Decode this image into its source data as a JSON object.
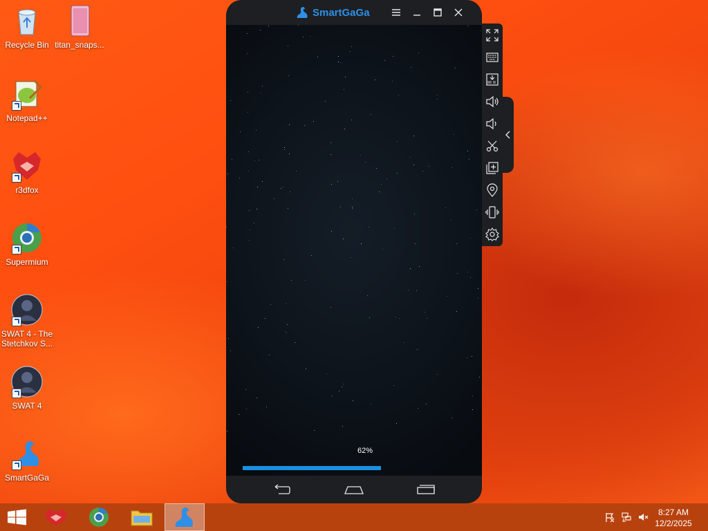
{
  "desktop": {
    "icons": [
      {
        "label": "Recycle Bin"
      },
      {
        "label": "titan_snaps..."
      },
      {
        "label": "Notepad++"
      },
      {
        "label": "r3dfox"
      },
      {
        "label": "Supermium"
      },
      {
        "label": "SWAT 4 - The Stetchkov S..."
      },
      {
        "label": "SWAT 4"
      },
      {
        "label": "SmartGaGa"
      }
    ]
  },
  "emulator": {
    "brand": "SmartGaGa",
    "title_buttons": [
      "menu-icon",
      "minimize-icon",
      "maximize-icon",
      "close-icon"
    ],
    "loading": {
      "progress_text": "62%",
      "progress": 0.62
    },
    "sidebar_tools": [
      "fullscreen-icon",
      "keyboard-icon",
      "install-apk-icon",
      "volume-up-icon",
      "volume-down-icon",
      "screenshot-icon",
      "multi-instance-icon",
      "location-icon",
      "shake-icon",
      "settings-icon"
    ],
    "nav_buttons": [
      "back-icon",
      "home-icon",
      "recents-icon"
    ]
  },
  "taskbar": {
    "apps": [
      "start-icon",
      "r3dfox-icon",
      "supermium-icon",
      "file-explorer-icon",
      "smartgaga-icon"
    ],
    "active_app": "smartgaga-icon",
    "tray_icons": [
      "action-center-flag-icon",
      "network-icon",
      "volume-muted-icon"
    ],
    "clock": {
      "time": "8:27 AM",
      "date": "12/2/2025"
    }
  },
  "colors": {
    "accent": "#1a8fe0",
    "taskbar": "#b8420e",
    "emulator_frame": "#1d1f22"
  }
}
